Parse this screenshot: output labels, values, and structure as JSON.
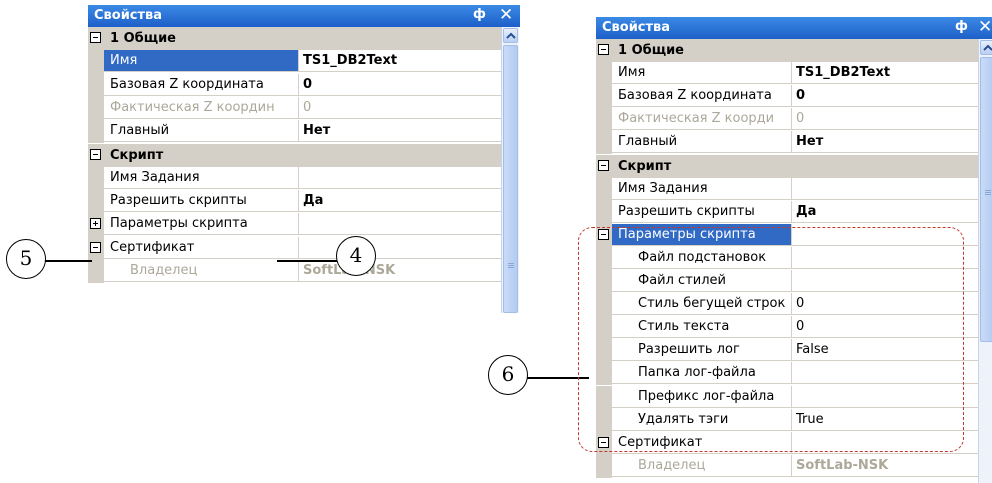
{
  "left_panel": {
    "title": "Свойства",
    "pin_glyph": "ф",
    "close_glyph": "✕",
    "rows": [
      {
        "type": "category",
        "label": "1 Общие"
      },
      {
        "type": "prop",
        "name": "Имя",
        "value": "TS1_DB2Text",
        "selected": true,
        "bold": true
      },
      {
        "type": "prop",
        "name": "Базовая Z координата",
        "value": "0",
        "bold": true
      },
      {
        "type": "prop",
        "name": "Фактическая Z координ",
        "value": "0",
        "disabled": true
      },
      {
        "type": "prop",
        "name": "Главный",
        "value": "Нет",
        "bold": true
      },
      {
        "type": "category",
        "label": "Скрипт"
      },
      {
        "type": "prop",
        "name": "Имя Задания",
        "value": ""
      },
      {
        "type": "prop",
        "name": "Разрешить скрипты",
        "value": "Да",
        "bold": true
      },
      {
        "type": "group",
        "name": "Параметры скрипта",
        "value": "",
        "expanded": false
      },
      {
        "type": "group",
        "name": "Сертификат",
        "value": "",
        "expanded": true
      },
      {
        "type": "prop",
        "name": "Владелец",
        "value": "SoftLab-NSK",
        "disabled": true,
        "bold": true,
        "indent": true
      }
    ]
  },
  "right_panel": {
    "title": "Свойства",
    "pin_glyph": "ф",
    "close_glyph": "✕",
    "rows": [
      {
        "type": "category",
        "label": "1 Общие"
      },
      {
        "type": "prop",
        "name": "Имя",
        "value": "TS1_DB2Text",
        "bold": true
      },
      {
        "type": "prop",
        "name": "Базовая Z координата",
        "value": "0",
        "bold": true
      },
      {
        "type": "prop",
        "name": "Фактическая Z коорди",
        "value": "0",
        "disabled": true
      },
      {
        "type": "prop",
        "name": "Главный",
        "value": "Нет",
        "bold": true
      },
      {
        "type": "category",
        "label": "Скрипт"
      },
      {
        "type": "prop",
        "name": "Имя Задания",
        "value": ""
      },
      {
        "type": "prop",
        "name": "Разрешить скрипты",
        "value": "Да",
        "bold": true
      },
      {
        "type": "group",
        "name": "Параметры скрипта",
        "value": "",
        "expanded": true,
        "selected": true
      },
      {
        "type": "prop",
        "name": "Файл подстановок",
        "value": "",
        "indent": true
      },
      {
        "type": "prop",
        "name": "Файл стилей",
        "value": "",
        "indent": true
      },
      {
        "type": "prop",
        "name": "Стиль бегущей строк",
        "value": "0",
        "indent": true
      },
      {
        "type": "prop",
        "name": "Стиль текста",
        "value": "0",
        "indent": true
      },
      {
        "type": "prop",
        "name": "Разрешить лог",
        "value": "False",
        "indent": true
      },
      {
        "type": "prop",
        "name": "Папка лог-файла",
        "value": "",
        "indent": true
      },
      {
        "type": "prop",
        "name": "Префикс лог-файла",
        "value": "",
        "indent": true
      },
      {
        "type": "prop",
        "name": "Удалять тэги",
        "value": "True",
        "indent": true
      },
      {
        "type": "group",
        "name": "Сертификат",
        "value": "",
        "expanded": true
      },
      {
        "type": "prop",
        "name": "Владелец",
        "value": "SoftLab-NSK",
        "disabled": true,
        "bold": true,
        "indent": true
      }
    ]
  },
  "callouts": {
    "c4": "4",
    "c5": "5",
    "c6": "6"
  },
  "colors": {
    "title": "#1d5fc8",
    "selection": "#316ac5",
    "category": "#d4d0c8",
    "dash": "#c0392b"
  }
}
